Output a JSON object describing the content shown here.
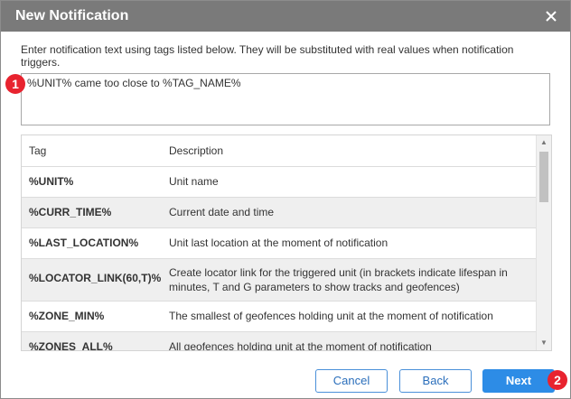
{
  "dialog": {
    "title": "New Notification",
    "close_icon": "close-icon"
  },
  "instructions": "Enter notification text using tags listed below. They will be substituted with real values when notification triggers.",
  "message": {
    "value": "%UNIT% came too close to %TAG_NAME%"
  },
  "markers": [
    "1",
    "2"
  ],
  "table": {
    "headers": {
      "tag": "Tag",
      "description": "Description"
    },
    "rows": [
      {
        "tag": "%UNIT%",
        "description": "Unit name"
      },
      {
        "tag": "%CURR_TIME%",
        "description": "Current date and time"
      },
      {
        "tag": "%LAST_LOCATION%",
        "description": "Unit last location at the moment of notification"
      },
      {
        "tag": "%LOCATOR_LINK(60,T)%",
        "description": "Create locator link for the triggered unit (in brackets indicate lifespan in minutes, T and G parameters to show tracks and geofences)"
      },
      {
        "tag": "%ZONE_MIN%",
        "description": "The smallest of geofences holding unit at the moment of notification"
      },
      {
        "tag": "%ZONES_ALL%",
        "description": "All geofences holding unit at the moment of notification"
      }
    ]
  },
  "buttons": {
    "cancel": "Cancel",
    "back": "Back",
    "next": "Next"
  }
}
